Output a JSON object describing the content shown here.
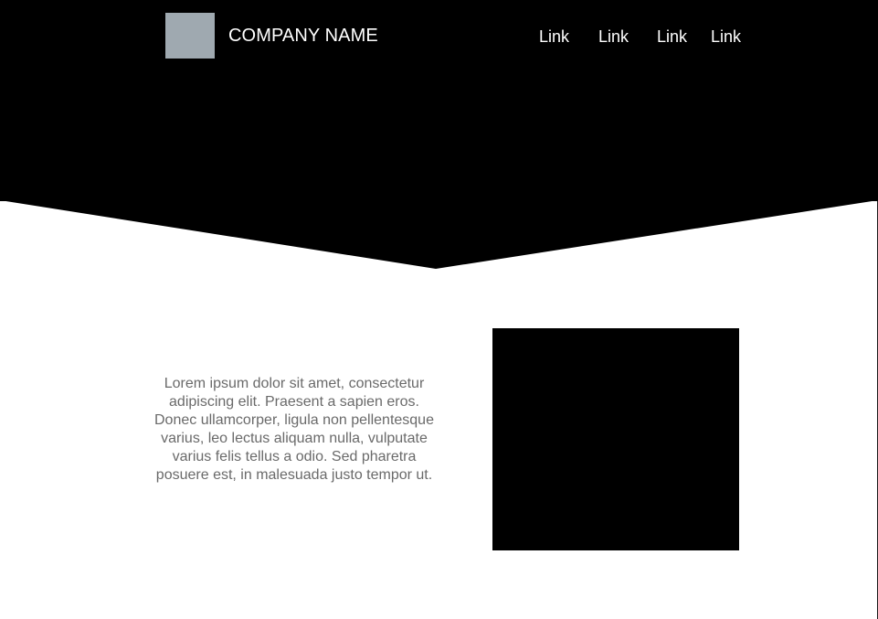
{
  "header": {
    "brand_name": "COMPANY NAME",
    "logo_color": "#9fa9b0",
    "background_color": "#000000",
    "nav_links": [
      {
        "label": "Link"
      },
      {
        "label": "Link"
      },
      {
        "label": "Link"
      },
      {
        "label": "Link"
      }
    ]
  },
  "main": {
    "paragraph": "Lorem ipsum dolor sit amet, consectetur adipiscing elit. Praesent a sapien eros. Donec ullamcorper, ligula non pellentesque varius, leo lectus aliquam nulla, vulputate varius felis tellus a odio. Sed pharetra posuere est, in malesuada justo tempor ut.",
    "text_color": "#6a6a6a",
    "media_color": "#000000"
  }
}
